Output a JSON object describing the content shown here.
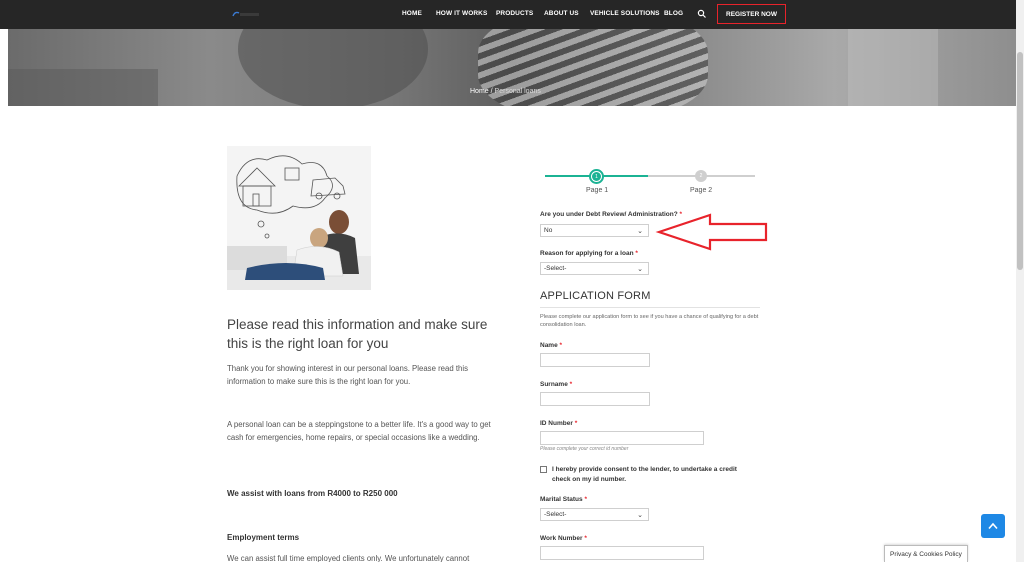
{
  "nav": {
    "items": [
      "HOME",
      "HOW IT WORKS",
      "PRODUCTS",
      "ABOUT US",
      "VEHICLE SOLUTIONS",
      "BLOG"
    ],
    "register_label": "REGISTER NOW",
    "icons": {
      "search": "search-icon",
      "logo": "logo"
    },
    "colors": {
      "bar": "#262626",
      "register_border": "#e8232b"
    }
  },
  "breadcrumb": {
    "home": "Home",
    "separator": "/",
    "current": "Personal loans"
  },
  "content": {
    "heading": "Please read this information and make sure this is the right loan for you",
    "para1": "Thank you for showing interest in our personal loans. Please read this information to make sure this is the right loan for you.",
    "para2": "A personal loan can be a steppingstone to a better life. It's a good way to get cash for emergencies, home repairs, or special occasions like a wedding.",
    "loan_range": "We assist with loans from R4000 to R250 000",
    "employment_heading": "Employment terms",
    "employment_para": "We can assist full time employed clients only. We unfortunately cannot"
  },
  "stepper": {
    "steps": [
      {
        "number": "1",
        "label": "Page 1"
      },
      {
        "number": "2",
        "label": "Page 2"
      }
    ],
    "active_color": "#1bb394",
    "inactive_color": "#cfcfcf"
  },
  "form": {
    "debt_review": {
      "label": "Are you under Debt Review/ Administration?",
      "required": "*",
      "value": "No"
    },
    "reason": {
      "label": "Reason for applying for a loan",
      "required": "*",
      "value": "-Select-"
    },
    "title": "APPLICATION FORM",
    "description": "Please complete our application form to see if you have a chance of qualifying for a debt consolidation loan.",
    "name": {
      "label": "Name",
      "required": "*",
      "value": ""
    },
    "surname": {
      "label": "Surname",
      "required": "*",
      "value": ""
    },
    "id_number": {
      "label": "ID Number",
      "required": "*",
      "value": "",
      "hint": "Please complete your correct id number"
    },
    "consent": {
      "label": "I hereby provide consent to the lender, to undertake a credit check on my id number.",
      "checked": false
    },
    "marital_status": {
      "label": "Marital Status",
      "required": "*",
      "value": "-Select-"
    },
    "work_number": {
      "label": "Work Number",
      "required": "*",
      "value": ""
    }
  },
  "floating": {
    "scroll_top_icon": "arrow-up-icon",
    "privacy_label": "Privacy & Cookies Policy",
    "accent": "#1e88e5"
  },
  "annotation": {
    "arrow_color": "#e8232b"
  }
}
